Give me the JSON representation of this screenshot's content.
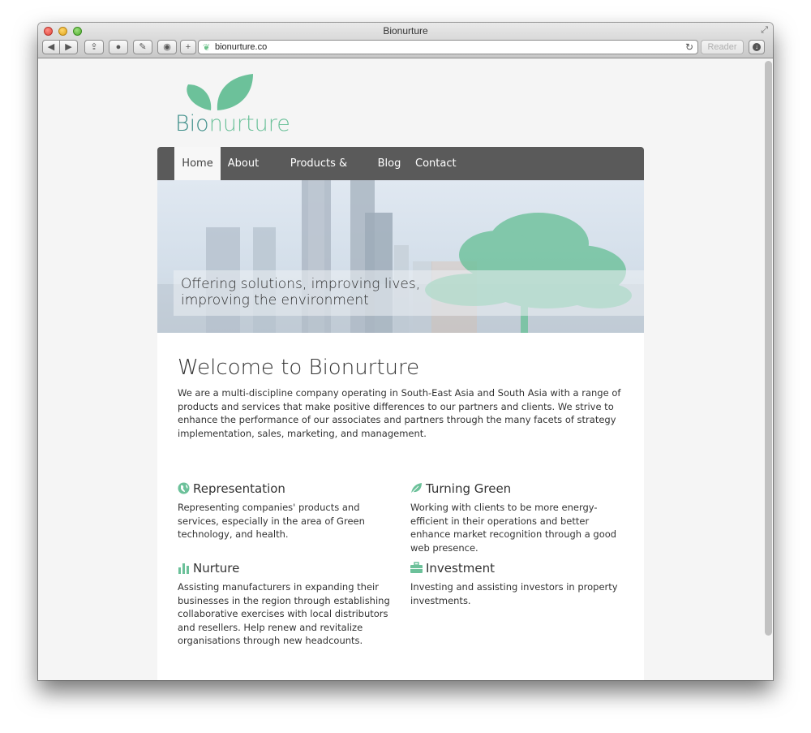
{
  "window": {
    "title": "Bionurture",
    "url": "bionurture.co",
    "reader_label": "Reader",
    "toolbar": {
      "back_icon": "◀",
      "forward_icon": "▶",
      "share_icon": "⇪",
      "history_icon": "●",
      "tools_icon": "✎",
      "extension_icon": "◉",
      "new_tab_icon": "+",
      "reload_icon": "↻",
      "download_icon": "↓",
      "fullscreen_icon": "⤢"
    }
  },
  "site": {
    "brand": {
      "prefix": "Bio",
      "suffix": "nurture",
      "color_prefix": "#3f8f8a",
      "color_suffix": "#6cc19a"
    },
    "nav": [
      {
        "label": "Home",
        "active": true
      },
      {
        "label": "About"
      },
      {
        "label": "Products & Services"
      },
      {
        "label": "Blog"
      },
      {
        "label": "Contact"
      }
    ],
    "hero": {
      "line1": "Offering solutions, improving lives,",
      "line2": "improving the environment"
    },
    "welcome": {
      "title": "Welcome to Bionurture",
      "text": "We are a multi-discipline company operating in South-East Asia and South Asia with a range of products and services that make positive differences to our partners and clients. We strive to enhance the performance of our associates and partners through the many facets of strategy implementation, sales, marketing, and management."
    },
    "features": [
      {
        "icon": "globe-icon",
        "title": "Representation",
        "text": "Representing companies' products and services, especially in the area of Green technology, and health."
      },
      {
        "icon": "leaf-icon",
        "title": "Turning Green",
        "text": "Working with clients to be more energy-efficient in their operations and better enhance market recognition through a good web presence."
      },
      {
        "icon": "bar-chart-icon",
        "title": "Nurture",
        "text": "Assisting manufacturers in expanding their businesses in the region through establishing collaborative exercises with local distributors and resellers. Help renew and revitalize organisations through new headcounts."
      },
      {
        "icon": "briefcase-icon",
        "title": "Investment",
        "text": "Investing and assisting investors in property investments."
      }
    ],
    "accent_color": "#6cc19a"
  }
}
